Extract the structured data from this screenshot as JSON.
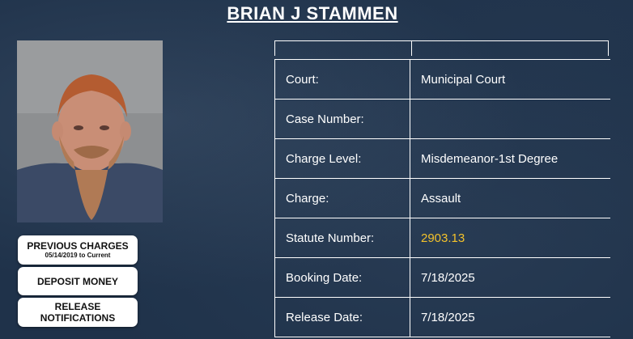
{
  "inmate": {
    "name": "BRIAN J STAMMEN"
  },
  "buttons": {
    "previous_charges": "PREVIOUS CHARGES",
    "previous_charges_range": "05/14/2019 to Current",
    "deposit_money": "DEPOSIT MONEY",
    "release_notifications": "RELEASE NOTIFICATIONS"
  },
  "charge_details": [
    {
      "label": "Court:",
      "value": "Municipal Court"
    },
    {
      "label": "Case Number:",
      "value": ""
    },
    {
      "label": "Charge Level:",
      "value": "Misdemeanor-1st Degree"
    },
    {
      "label": "Charge:",
      "value": "Assault"
    },
    {
      "label": "Statute Number:",
      "value": "2903.13"
    },
    {
      "label": "Booking Date:",
      "value": "7/18/2025"
    },
    {
      "label": "Release Date:",
      "value": "7/18/2025"
    }
  ],
  "colors": {
    "background": "#1f324a",
    "statute_highlight": "#f4c22b"
  }
}
